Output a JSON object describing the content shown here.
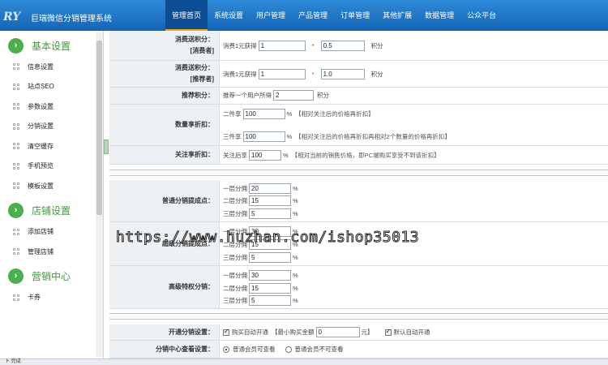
{
  "header": {
    "logo_text": "R",
    "logo_suffix": "Y",
    "app_title": "巨瑞微信分销管理系统",
    "nav": [
      {
        "label": "管理首页",
        "active": true
      },
      {
        "label": "系统设置"
      },
      {
        "label": "用户管理"
      },
      {
        "label": "产品管理"
      },
      {
        "label": "订单管理"
      },
      {
        "label": "其他扩展"
      },
      {
        "label": "数据管理"
      },
      {
        "label": "公众平台"
      }
    ]
  },
  "sidebar": {
    "sections": [
      {
        "title": "基本设置",
        "items": [
          "信息设置",
          "站点SEO",
          "参数设置",
          "分销设置",
          "清空缓存",
          "手机预览",
          "模板设置"
        ]
      },
      {
        "title": "店铺设置",
        "items": [
          "添加店铺",
          "管理店铺"
        ]
      },
      {
        "title": "营销中心",
        "items": [
          "卡券"
        ]
      }
    ]
  },
  "form": {
    "consume_points": {
      "label_line1": "消费送积分：",
      "label_line2": "[消费者]",
      "prefix": "消费1元获得",
      "value": "1",
      "star": "*",
      "value2": "0.5",
      "unit": "积分"
    },
    "consume_points_referrer": {
      "label_line1": "消费送积分：",
      "label_line2": "[推荐者]",
      "prefix": "消费1元获得",
      "value": "1",
      "star": "*",
      "value2": "1.0",
      "unit": "积分"
    },
    "referral_points": {
      "label": "推荐积分：",
      "prefix": "推荐一个用户所得",
      "value": "2",
      "unit": "积分"
    },
    "quantity_discount": {
      "label": "数量享折扣：",
      "line1_prefix": "二件享",
      "line1_value": "100",
      "line1_suffix": "%",
      "line1_note": "【相对关注后的价格再折扣】",
      "line2_prefix": "三件享",
      "line2_value": "100",
      "line2_suffix": "%",
      "line2_note": "【相对关注后的价格再折扣再相对2个数量的价格再折扣】"
    },
    "follow_discount": {
      "label": "关注享折扣：",
      "prefix": "关注后享",
      "value": "100",
      "suffix": "%",
      "note": "【相对当前的销售价格，即PC端购买享受不到该折扣】"
    },
    "normal_commission": {
      "label": "普通分销提成点：",
      "lines": [
        {
          "prefix": "一层分佣",
          "value": "20",
          "suffix": "%"
        },
        {
          "prefix": "二层分佣",
          "value": "15",
          "suffix": "%"
        },
        {
          "prefix": "三层分佣",
          "value": "5",
          "suffix": "%"
        }
      ]
    },
    "mid_commission": {
      "label": "超级分销提成点：",
      "lines": [
        {
          "prefix": "一层分佣",
          "value": "30",
          "suffix": "%"
        },
        {
          "prefix": "二层分佣",
          "value": "15",
          "suffix": "%"
        },
        {
          "prefix": "三层分佣",
          "value": "5",
          "suffix": "%"
        }
      ]
    },
    "vip_commission": {
      "label": "高级特权分销：",
      "lines": [
        {
          "prefix": "一层分佣",
          "value": "30",
          "suffix": "%"
        },
        {
          "prefix": "二层分佣",
          "value": "15",
          "suffix": "%"
        },
        {
          "prefix": "三层分佣",
          "value": "5",
          "suffix": "%"
        }
      ]
    },
    "enable_distribution": {
      "label": "开通分销设置：",
      "opt1": "购买自动开通",
      "min_label": "【最小购买金额",
      "min_value": "0",
      "min_unit": "元】",
      "opt2": "默认自动开通"
    },
    "view_center": {
      "label": "分销中心查看设置：",
      "opt1": "普通会员可查看",
      "opt2": "普通会员不可查看"
    }
  },
  "watermark": "https://www.huzhan.com/ishop35013",
  "status_bar": "ト  完成"
}
